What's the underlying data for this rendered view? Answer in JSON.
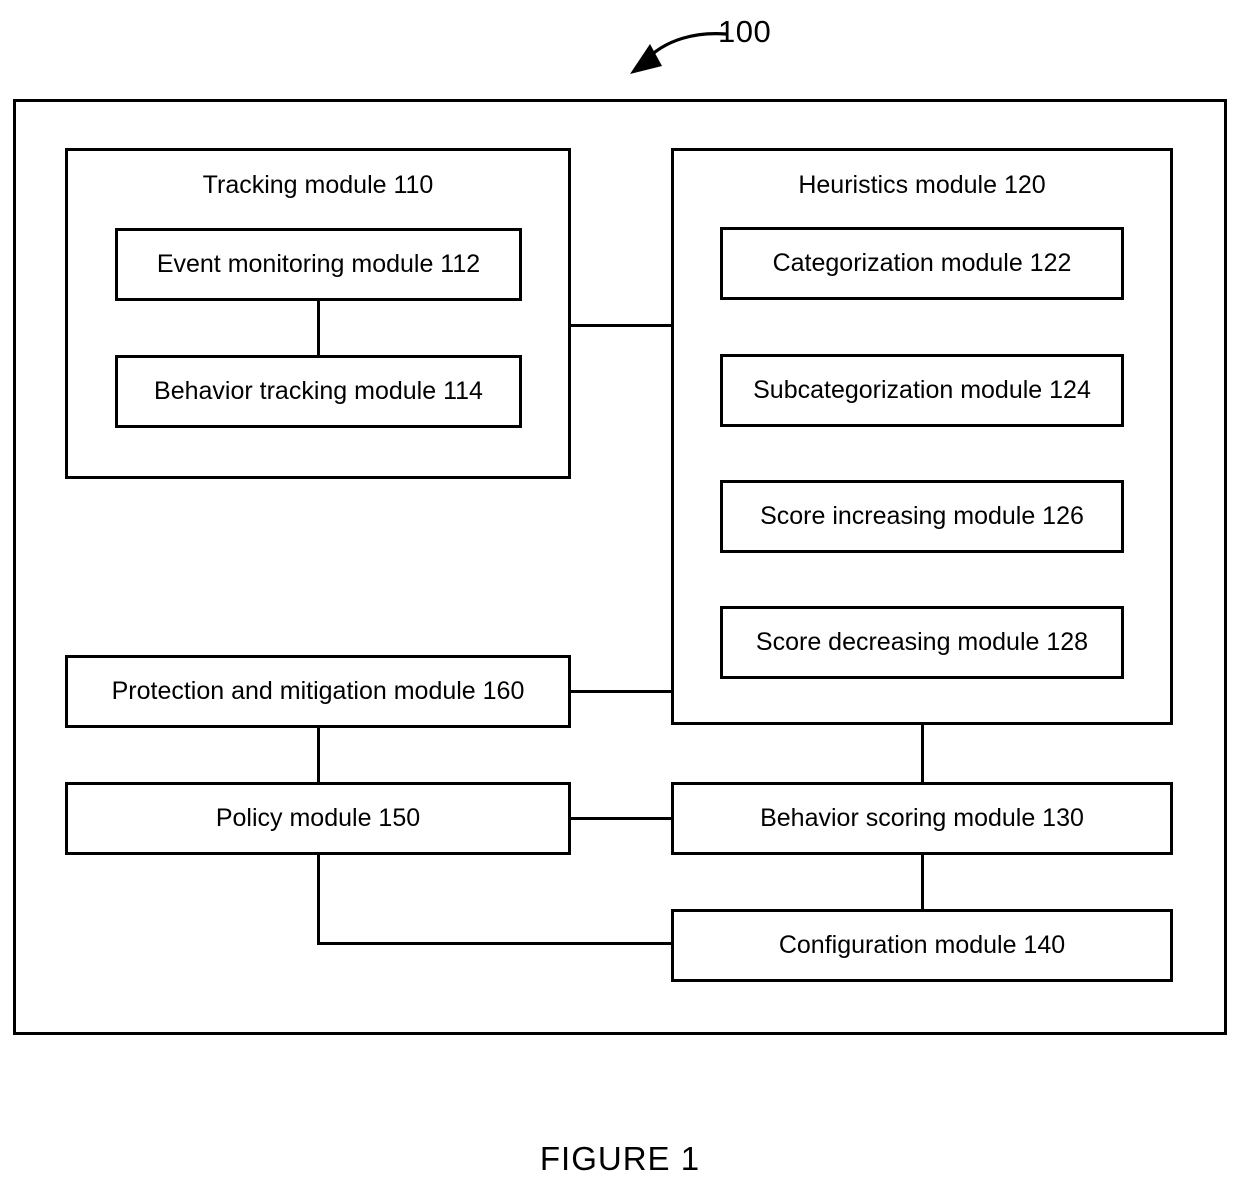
{
  "figure": {
    "reference_numeral": "100",
    "caption": "FIGURE 1",
    "callout_icon": "curved-arrow-icon"
  },
  "diagram": {
    "type": "block-diagram",
    "groups": [
      {
        "id": "tracking",
        "title": "Tracking module 110",
        "children": [
          {
            "id": "event-monitoring",
            "label": "Event monitoring module 112"
          },
          {
            "id": "behavior-tracking",
            "label": "Behavior tracking module 114"
          }
        ]
      },
      {
        "id": "heuristics",
        "title": "Heuristics module 120",
        "children": [
          {
            "id": "categorization",
            "label": "Categorization module 122"
          },
          {
            "id": "subcategorization",
            "label": "Subcategorization module 124"
          },
          {
            "id": "score-increasing",
            "label": "Score increasing module 126"
          },
          {
            "id": "score-decreasing",
            "label": "Score decreasing module 128"
          }
        ]
      }
    ],
    "blocks": [
      {
        "id": "protection-mitigation",
        "label": "Protection and mitigation module 160"
      },
      {
        "id": "policy",
        "label": "Policy module 150"
      },
      {
        "id": "behavior-scoring",
        "label": "Behavior scoring module 130"
      },
      {
        "id": "configuration",
        "label": "Configuration module 140"
      }
    ],
    "connections": [
      {
        "from": "event-monitoring",
        "to": "behavior-tracking"
      },
      {
        "from": "tracking",
        "to": "heuristics"
      },
      {
        "from": "protection-mitigation",
        "to": "heuristics"
      },
      {
        "from": "protection-mitigation",
        "to": "policy"
      },
      {
        "from": "policy",
        "to": "behavior-scoring"
      },
      {
        "from": "heuristics",
        "to": "behavior-scoring"
      },
      {
        "from": "behavior-scoring",
        "to": "configuration"
      },
      {
        "from": "policy",
        "to": "configuration"
      }
    ],
    "line_color": "#000000",
    "background_color": "#ffffff"
  }
}
